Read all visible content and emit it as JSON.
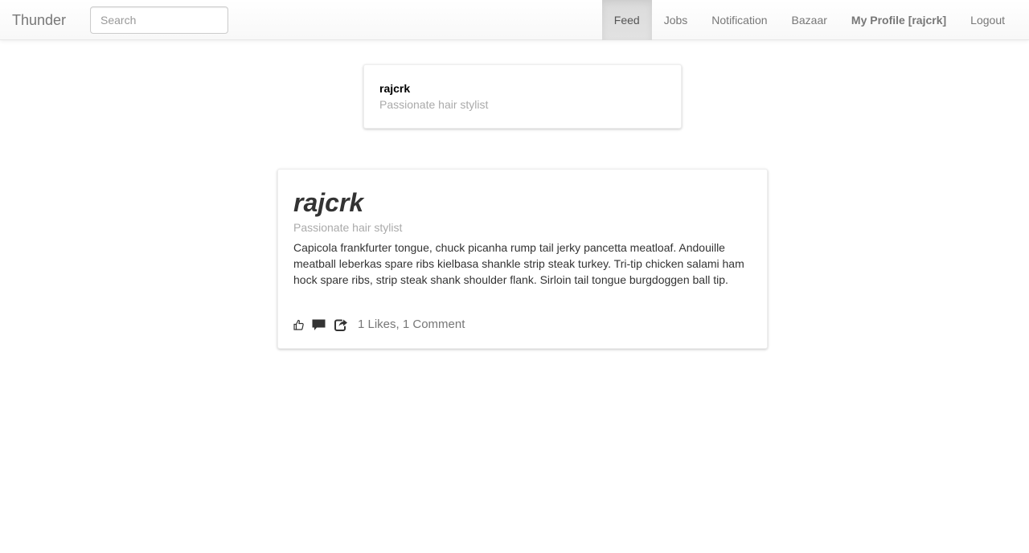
{
  "navbar": {
    "brand": "Thunder",
    "search": {
      "placeholder": "Search",
      "value": ""
    },
    "items": [
      {
        "label": "Feed",
        "active": true
      },
      {
        "label": "Jobs",
        "active": false
      },
      {
        "label": "Notification",
        "active": false
      },
      {
        "label": "Bazaar",
        "active": false
      },
      {
        "label": "My Profile [rajcrk]",
        "active": false
      },
      {
        "label": "Logout",
        "active": false
      }
    ]
  },
  "profile_card": {
    "username": "rajcrk",
    "tagline": "Passionate hair stylist"
  },
  "post": {
    "author": "rajcrk",
    "tagline": "Passionate hair stylist",
    "body": "Capicola frankfurter tongue, chuck picanha rump tail jerky pancetta meatloaf. Andouille meatball leberkas spare ribs kielbasa shankle strip steak turkey. Tri-tip chicken salami ham hock spare ribs, strip steak shank shoulder flank. Sirloin tail tongue burgdoggen ball tip.",
    "actions": {
      "like_icon": "thumbs-up-icon",
      "comment_icon": "comment-icon",
      "share_icon": "share-icon"
    },
    "stats": "1 Likes, 1 Comment"
  },
  "colors": {
    "nav_text": "#777777",
    "nav_active_bg": "#dbdbdb",
    "muted_text": "#aaaaaa",
    "body_text": "#333333"
  }
}
